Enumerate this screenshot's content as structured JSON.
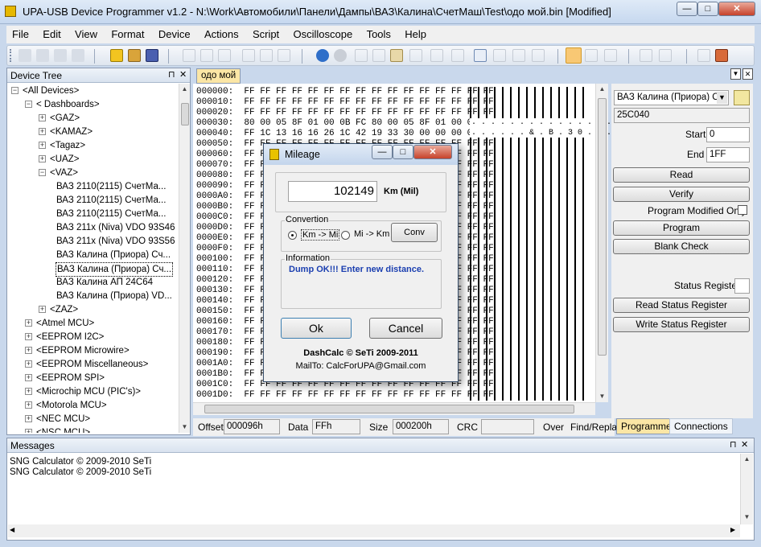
{
  "window": {
    "title": "UPA-USB Device Programmer v1.2 - N:\\Work\\Автомобили\\Панели\\Дампы\\ВАЗ\\Калина\\СчетМаш\\Test\\одо мой.bin [Modified]",
    "btn_min": "—",
    "btn_max": "□",
    "btn_close": "✕"
  },
  "menu": [
    "File",
    "Edit",
    "View",
    "Format",
    "Device",
    "Actions",
    "Script",
    "Oscilloscope",
    "Tools",
    "Help"
  ],
  "device_tree": {
    "header": "Device Tree",
    "pin": "⊓",
    "close": "✕",
    "nodes": [
      {
        "label": "<All Devices>",
        "level": 0,
        "toggle": "−"
      },
      {
        "label": "< Dashboards>",
        "level": 1,
        "toggle": "−"
      },
      {
        "label": "<GAZ>",
        "level": 2,
        "toggle": "+"
      },
      {
        "label": "<KAMAZ>",
        "level": 2,
        "toggle": "+"
      },
      {
        "label": "<Tagaz>",
        "level": 2,
        "toggle": "+"
      },
      {
        "label": "<UAZ>",
        "level": 2,
        "toggle": "+"
      },
      {
        "label": "<VAZ>",
        "level": 2,
        "toggle": "−"
      },
      {
        "label": "ВАЗ 2110(2115) СчетМа...",
        "level": 3,
        "toggle": ""
      },
      {
        "label": "ВАЗ 2110(2115) СчетМа...",
        "level": 3,
        "toggle": ""
      },
      {
        "label": "ВАЗ 2110(2115) СчетМа...",
        "level": 3,
        "toggle": ""
      },
      {
        "label": "ВАЗ 211x (Niva) VDO 93S46",
        "level": 3,
        "toggle": ""
      },
      {
        "label": "ВАЗ 211x (Niva) VDO 93S56",
        "level": 3,
        "toggle": ""
      },
      {
        "label": "ВАЗ Калина (Приора) Сч...",
        "level": 3,
        "toggle": ""
      },
      {
        "label": "ВАЗ Калина (Приора) Сч...",
        "level": 3,
        "toggle": "",
        "selected": true
      },
      {
        "label": "ВАЗ Калина АП 24C64",
        "level": 3,
        "toggle": ""
      },
      {
        "label": "ВАЗ Калина (Приора) VD...",
        "level": 3,
        "toggle": ""
      },
      {
        "label": "<ZAZ>",
        "level": 2,
        "toggle": "+"
      },
      {
        "label": "<Atmel MCU>",
        "level": 1,
        "toggle": "+"
      },
      {
        "label": "<EEPROM I2C>",
        "level": 1,
        "toggle": "+"
      },
      {
        "label": "<EEPROM Microwire>",
        "level": 1,
        "toggle": "+"
      },
      {
        "label": "<EEPROM Miscellaneous>",
        "level": 1,
        "toggle": "+"
      },
      {
        "label": "<EEPROM SPI>",
        "level": 1,
        "toggle": "+"
      },
      {
        "label": "<Microchip MCU (PIC's)>",
        "level": 1,
        "toggle": "+"
      },
      {
        "label": "<Motorola MCU>",
        "level": 1,
        "toggle": "+"
      },
      {
        "label": "<NEC MCU>",
        "level": 1,
        "toggle": "+"
      },
      {
        "label": "<NSC MCU>",
        "level": 1,
        "toggle": "+"
      }
    ]
  },
  "doc_tab": "одо мой",
  "hex": {
    "rows": [
      {
        "addr": "000000:",
        "bytes": "FF FF FF FF FF FF FF FF FF FF FF FF FF FF FF FF"
      },
      {
        "addr": "000010:",
        "bytes": "FF FF FF FF FF FF FF FF FF FF FF FF FF FF FF FF"
      },
      {
        "addr": "000020:",
        "bytes": "FF FF FF FF FF FF FF FF FF FF FF FF FF FF FF FF"
      },
      {
        "addr": "000030:",
        "bytes": "80 00 05 8F 01 00 0B FC 80 00 05 8F 01 00 0B 48"
      },
      {
        "addr": "000040:",
        "bytes": "FF 1C 13 16 16 26 1C 42 19 33 30 00 00 00 00 00"
      },
      {
        "addr": "000050:",
        "bytes": "FF FF FF FF FF FF FF FF FF FF FF FF FF FF FF FF"
      },
      {
        "addr": "000060:",
        "bytes": "FF FF FF FF FF FF FF FF FF FF FF FF FF FF FF FF"
      },
      {
        "addr": "000070:",
        "bytes": "FF FF FF FF FF FF FF FF FF FF FF FF FF FF FF FF"
      },
      {
        "addr": "000080:",
        "bytes": "FF FF FF FF FF FF FF FF FF FF FF FF FF FF FF FF"
      },
      {
        "addr": "000090:",
        "bytes": "FF FF FF FF FF FF FF FF FF FF FF FF FF FF FF FF"
      },
      {
        "addr": "0000A0:",
        "bytes": "FF FF FF FF FF FF FF FF FF FF FF FF FF FF FF FF"
      },
      {
        "addr": "0000B0:",
        "bytes": "FF FF FF FF FF FF FF FF FF FF FF FF FF FF FF FF"
      },
      {
        "addr": "0000C0:",
        "bytes": "FF FF FF FF FF FF FF FF FF FF FF FF FF FF FF FF"
      },
      {
        "addr": "0000D0:",
        "bytes": "FF FF FF FF FF FF FF FF FF FF FF FF FF FF FF FF"
      },
      {
        "addr": "0000E0:",
        "bytes": "FF FF FF FF FF FF FF FF FF FF FF FF FF FF FF FF"
      },
      {
        "addr": "0000F0:",
        "bytes": "FF FF FF FF FF FF FF FF FF FF FF FF FF FF FF FF"
      },
      {
        "addr": "000100:",
        "bytes": "FF FF FF FF FF FF FF FF FF FF FF FF FF FF FF FF"
      },
      {
        "addr": "000110:",
        "bytes": "FF FF FF FF FF FF FF FF FF FF FF FF FF FF FF FF"
      },
      {
        "addr": "000120:",
        "bytes": "FF FF FF FF FF FF FF FF FF FF FF FF FF FF FF FF"
      },
      {
        "addr": "000130:",
        "bytes": "FF FF FF FF FF FF FF FF FF FF FF FF FF FF FF FF"
      },
      {
        "addr": "000140:",
        "bytes": "FF FF FF FF FF FF FF FF FF FF FF FF FF FF FF FF"
      },
      {
        "addr": "000150:",
        "bytes": "FF FF FF FF FF FF FF FF FF FF FF FF FF FF FF FF"
      },
      {
        "addr": "000160:",
        "bytes": "FF FF FF FF FF FF FF FF FF FF FF FF FF FF FF FF"
      },
      {
        "addr": "000170:",
        "bytes": "FF FF FF FF FF FF FF FF FF FF FF FF FF FF FF FF"
      },
      {
        "addr": "000180:",
        "bytes": "FF FF FF FF FF FF FF FF FF FF FF FF FF FF FF FF"
      },
      {
        "addr": "000190:",
        "bytes": "FF FF FF FF FF FF FF FF FF FF FF FF FF FF FF FF"
      },
      {
        "addr": "0001A0:",
        "bytes": "FF FF FF FF FF FF FF FF FF FF FF FF FF FF FF FF"
      },
      {
        "addr": "0001B0:",
        "bytes": "FF FF FF FF FF FF FF FF FF FF FF FF FF FF FF FF"
      },
      {
        "addr": "0001C0:",
        "bytes": "FF FF FF FF FF FF FF FF FF FF FF FF FF FF FF FF"
      },
      {
        "addr": "0001D0:",
        "bytes": "FF FF FF FF FF FF FF FF FF FF FF FF FF FF FF FF"
      }
    ],
    "ascii_30": ". . . . . . . . . . . . . . . . H",
    "ascii_40": ". . . . . . & . B . 3 0 . . . . ."
  },
  "status": {
    "offset_label": "Offset",
    "offset_value": "000096h",
    "data_label": "Data",
    "data_value": "FFh",
    "size_label": "Size",
    "size_value": "000200h",
    "crc_label": "CRC",
    "crc_value": "",
    "over_label": "Over",
    "findrepl_label": "Find/Repla"
  },
  "right_panel": {
    "device_select": "ВАЗ Калина (Приора) Сч",
    "device_id": "25C040",
    "start_label": "Start",
    "start_value": "0",
    "end_label": "End",
    "end_value": "1FF",
    "read": "Read",
    "verify": "Verify",
    "program_modified_only": "Program Modified Only",
    "program": "Program",
    "blank_check": "Blank Check",
    "status_register": "Status Register",
    "read_status": "Read Status Register",
    "write_status": "Write Status Register",
    "tab_programmer": "Programmer",
    "tab_connections": "Connections"
  },
  "messages": {
    "header": "Messages",
    "lines": [
      "SNG Calculator  © 2009-2010 SeTi",
      "SNG Calculator  © 2009-2010 SeTi"
    ]
  },
  "dialog": {
    "title": "Mileage",
    "value": "102149",
    "unit": "Km (Mil)",
    "convertion": "Convertion",
    "km_to_mi": "Km -> Mi",
    "mi_to_km": "Mi -> Km",
    "conv": "Conv",
    "information": "Information",
    "info_text": "Dump OK!!! Enter new distance.",
    "ok": "Ok",
    "cancel": "Cancel",
    "credit": "DashCalc © SeTi 2009-2011",
    "mail": "MailTo: CalcForUPA@Gmail.com"
  },
  "colors": {
    "accent": "#3a6ea5",
    "info_text": "#1b3fb0",
    "tab_active": "#fbe6a5"
  },
  "icons": [
    "app-icon",
    "new-icon",
    "open-icon",
    "save-icon",
    "bold-icon",
    "italic-icon",
    "underline-icon",
    "align-left-icon",
    "align-center-icon",
    "align-right-icon",
    "refresh-icon",
    "stop-icon",
    "cut-icon",
    "copy-icon",
    "paste-icon",
    "delete-icon",
    "find-icon",
    "replace-icon",
    "page-icon",
    "pointer-icon",
    "zoom-icon",
    "play-icon",
    "record-icon",
    "tools-icon",
    "browse-icon"
  ]
}
